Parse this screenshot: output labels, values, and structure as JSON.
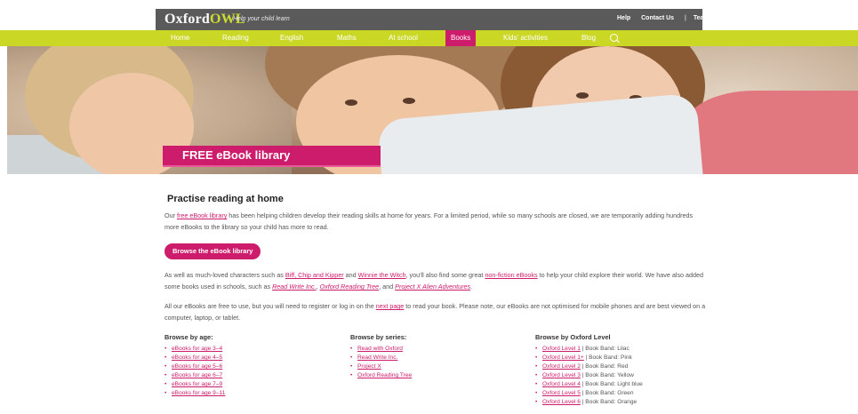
{
  "header": {
    "logo_main": "Oxford",
    "logo_owl": "OWL",
    "tagline": "Help your child learn",
    "links": [
      "Help",
      "Contact Us",
      "Teachers"
    ]
  },
  "nav": {
    "items": [
      "Home",
      "Reading",
      "English",
      "Maths",
      "At school",
      "Books",
      "Kids' activities",
      "Blog"
    ],
    "active": "Books",
    "search_icon": "search-icon"
  },
  "hero": {
    "banner_title": "FREE eBook library"
  },
  "main": {
    "heading": "Practise reading at home",
    "intro": {
      "pre": "Our ",
      "link": "free eBook library",
      "post": " has been helping children develop their reading skills at home for years. For a limited period, while so many schools are closed, we are temporarily adding hundreds more eBooks to the library so your child has more to read."
    },
    "button_label": "Browse the eBook library",
    "characters": {
      "t1": "As well as much-loved characters such as ",
      "l1": "Biff, Chip and Kipper",
      "t2": " and ",
      "l2": "Winnie the Witch",
      "t3": ", you'll also find some great ",
      "l3": "non-fiction eBooks",
      "t4": " to help your child explore their world. We have also added some books used in schools, such as ",
      "l4": "Read Write Inc.",
      "t5": ", ",
      "l5": "Oxford Reading Tree",
      "t6": ", and ",
      "l6": "Project X Alien Adventures",
      "t7": "."
    },
    "free": {
      "t1": "All our eBooks are free to use, but you will need to register or log in on the ",
      "l1": "next page",
      "t2": " to read your book. Please note, our eBooks are not optimised for mobile phones and are best viewed on a computer, laptop, or tablet."
    }
  },
  "browse": {
    "by_age": {
      "title": "Browse by age:",
      "items": [
        "eBooks for age 3–4",
        "eBooks for age 4–5",
        "eBooks for age 5–6",
        "eBooks for age 6–7",
        "eBooks for age 7–9",
        "eBooks for age 9–11"
      ]
    },
    "by_series": {
      "title": "Browse by series:",
      "items": [
        "Read with Oxford",
        "Read Write Inc.",
        "Project X",
        "Oxford Reading Tree"
      ]
    },
    "by_level": {
      "title": "Browse by Oxford Level",
      "items": [
        {
          "level": "Oxford Level 1",
          "band": " | Book Band: Lilac"
        },
        {
          "level": "Oxford Level 1+",
          "band": " | Book Band: Pink"
        },
        {
          "level": "Oxford Level 2",
          "band": " | Book Band: Red"
        },
        {
          "level": "Oxford Level 3",
          "band": " | Book Band: Yellow"
        },
        {
          "level": "Oxford Level 4",
          "band": " | Book Band: Light blue"
        },
        {
          "level": "Oxford Level 5",
          "band": " | Book Band: Green"
        },
        {
          "level": "Oxford Level 6",
          "band": " | Book Band: Orange"
        }
      ]
    }
  },
  "colors": {
    "brand_pink": "#cc1c6b",
    "nav_green": "#cad725",
    "header_grey": "#5a5a5a"
  }
}
